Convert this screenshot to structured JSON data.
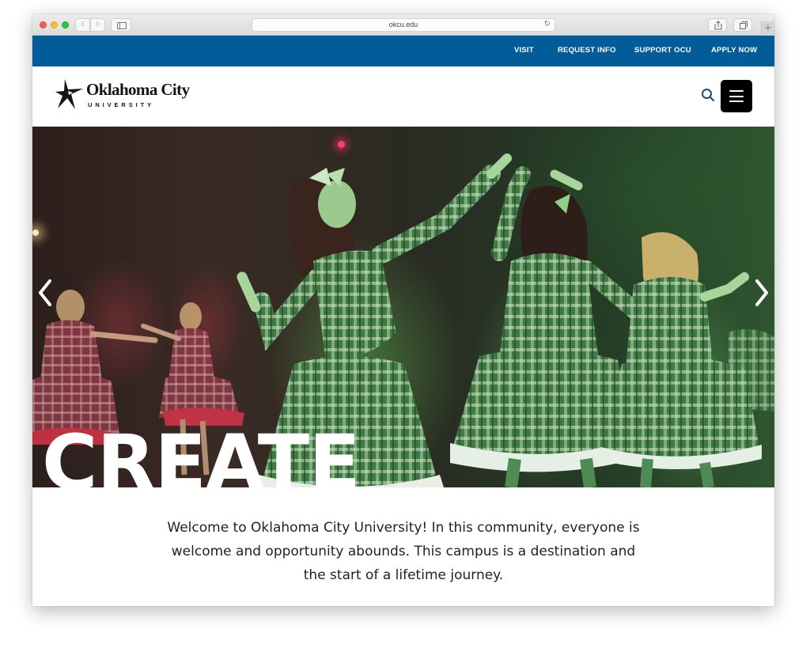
{
  "browser": {
    "url": "okcu.edu",
    "back_icon": "chevron-left-icon",
    "forward_icon": "chevron-right-icon",
    "sidebar_icon": "sidebar-icon",
    "reload_icon": "reload-icon",
    "share_icon": "share-icon",
    "tabs_icon": "tabs-icon",
    "new_tab_icon": "plus-icon"
  },
  "utility_nav": {
    "background": "#035c9a",
    "items": [
      {
        "label": "VISIT"
      },
      {
        "label": "REQUEST INFO"
      },
      {
        "label": "SUPPORT OCU"
      },
      {
        "label": "APPLY NOW"
      }
    ]
  },
  "header": {
    "logo": {
      "name": "Oklahoma City",
      "subtitle": "UNIVERSITY",
      "icon": "star-logo-icon"
    },
    "search_icon": "search-icon",
    "menu_icon": "hamburger-menu-icon"
  },
  "hero": {
    "headline": "CREATE",
    "prev_icon": "chevron-left-icon",
    "next_icon": "chevron-right-icon"
  },
  "intro": {
    "text": "Welcome to Oklahoma City University! In this community, everyone is welcome and opportunity abounds. This campus is a destination and the start of a lifetime journey."
  }
}
